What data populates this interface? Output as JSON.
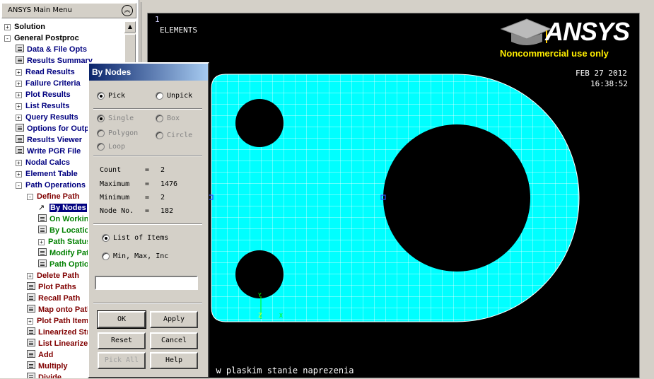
{
  "main_menu": {
    "title": "ANSYS Main Menu",
    "collapse_icon": "double-chevron-up-icon",
    "items": [
      {
        "label": "Solution",
        "expander": "+",
        "color": "black",
        "indent": 0
      },
      {
        "label": "General Postproc",
        "expander": "-",
        "color": "black",
        "indent": 0
      },
      {
        "label": "Data & File Opts",
        "icon": "file",
        "color": "blue",
        "indent": 1
      },
      {
        "label": "Results Summary",
        "icon": "file",
        "color": "blue",
        "indent": 1
      },
      {
        "label": "Read Results",
        "expander": "+",
        "color": "blue",
        "indent": 1
      },
      {
        "label": "Failure Criteria",
        "expander": "+",
        "color": "blue",
        "indent": 1
      },
      {
        "label": "Plot Results",
        "expander": "+",
        "color": "blue",
        "indent": 1
      },
      {
        "label": "List Results",
        "expander": "+",
        "color": "blue",
        "indent": 1
      },
      {
        "label": "Query Results",
        "expander": "+",
        "color": "blue",
        "indent": 1
      },
      {
        "label": "Options for Output",
        "icon": "file",
        "color": "blue",
        "indent": 1
      },
      {
        "label": "Results Viewer",
        "icon": "file",
        "color": "blue",
        "indent": 1
      },
      {
        "label": "Write PGR File",
        "icon": "file",
        "color": "blue",
        "indent": 1
      },
      {
        "label": "Nodal Calcs",
        "expander": "+",
        "color": "blue",
        "indent": 1
      },
      {
        "label": "Element Table",
        "expander": "+",
        "color": "blue",
        "indent": 1
      },
      {
        "label": "Path Operations",
        "expander": "-",
        "color": "blue",
        "indent": 1
      },
      {
        "label": "Define Path",
        "expander": "-",
        "color": "maroon",
        "indent": 2
      },
      {
        "label": "By Nodes",
        "icon": "arrow",
        "color": "green",
        "indent": 3,
        "selected": true
      },
      {
        "label": "On Working Plane",
        "icon": "file",
        "color": "green",
        "indent": 3
      },
      {
        "label": "By Location",
        "icon": "file",
        "color": "green",
        "indent": 3
      },
      {
        "label": "Path Status",
        "expander": "+",
        "color": "green",
        "indent": 3
      },
      {
        "label": "Modify Path",
        "icon": "file",
        "color": "green",
        "indent": 3
      },
      {
        "label": "Path Options",
        "icon": "file",
        "color": "green",
        "indent": 3
      },
      {
        "label": "Delete Path",
        "expander": "+",
        "color": "maroon",
        "indent": 2
      },
      {
        "label": "Plot Paths",
        "icon": "file",
        "color": "maroon",
        "indent": 2
      },
      {
        "label": "Recall Path",
        "icon": "file",
        "color": "maroon",
        "indent": 2
      },
      {
        "label": "Map onto Path",
        "icon": "file",
        "color": "maroon",
        "indent": 2
      },
      {
        "label": "Plot Path Item",
        "expander": "+",
        "color": "maroon",
        "indent": 2
      },
      {
        "label": "Linearized Strs",
        "icon": "file",
        "color": "maroon",
        "indent": 2
      },
      {
        "label": "List Linearized",
        "icon": "file",
        "color": "maroon",
        "indent": 2
      },
      {
        "label": "Add",
        "icon": "file",
        "color": "maroon",
        "indent": 2
      },
      {
        "label": "Multiply",
        "icon": "file",
        "color": "maroon",
        "indent": 2
      },
      {
        "label": "Divide",
        "icon": "file",
        "color": "maroon",
        "indent": 2
      }
    ]
  },
  "dialog": {
    "title": "By Nodes",
    "mode": {
      "pick": "Pick",
      "unpick": "Unpick",
      "selected": "pick"
    },
    "shapes": [
      "Single",
      "Box",
      "Polygon",
      "Circle",
      "Loop"
    ],
    "info": {
      "count_label": "Count",
      "count": "2",
      "max_label": "Maximum",
      "max": "1476",
      "min_label": "Minimum",
      "min": "2",
      "node_label": "Node No.",
      "node": "182"
    },
    "list_mode": {
      "list": "List of Items",
      "minmax": "Min, Max, Inc",
      "selected": "list"
    },
    "input_value": "",
    "buttons": {
      "ok": "OK",
      "apply": "Apply",
      "reset": "Reset",
      "cancel": "Cancel",
      "pick_all": "Pick All",
      "help": "Help"
    }
  },
  "graphics": {
    "window_number": "1",
    "plot_label": "ELEMENTS",
    "logo_text": "ANSYS",
    "logo_subtext": "Noncommercial use only",
    "date": "FEB 27 2012",
    "time": "16:38:52",
    "footer_text": ": w plaskim stanie naprezenia",
    "axis_y": "Y",
    "axis_z": "Z",
    "axis_x": "X",
    "mesh_color": "#00ffff",
    "background_color": "#000000"
  }
}
